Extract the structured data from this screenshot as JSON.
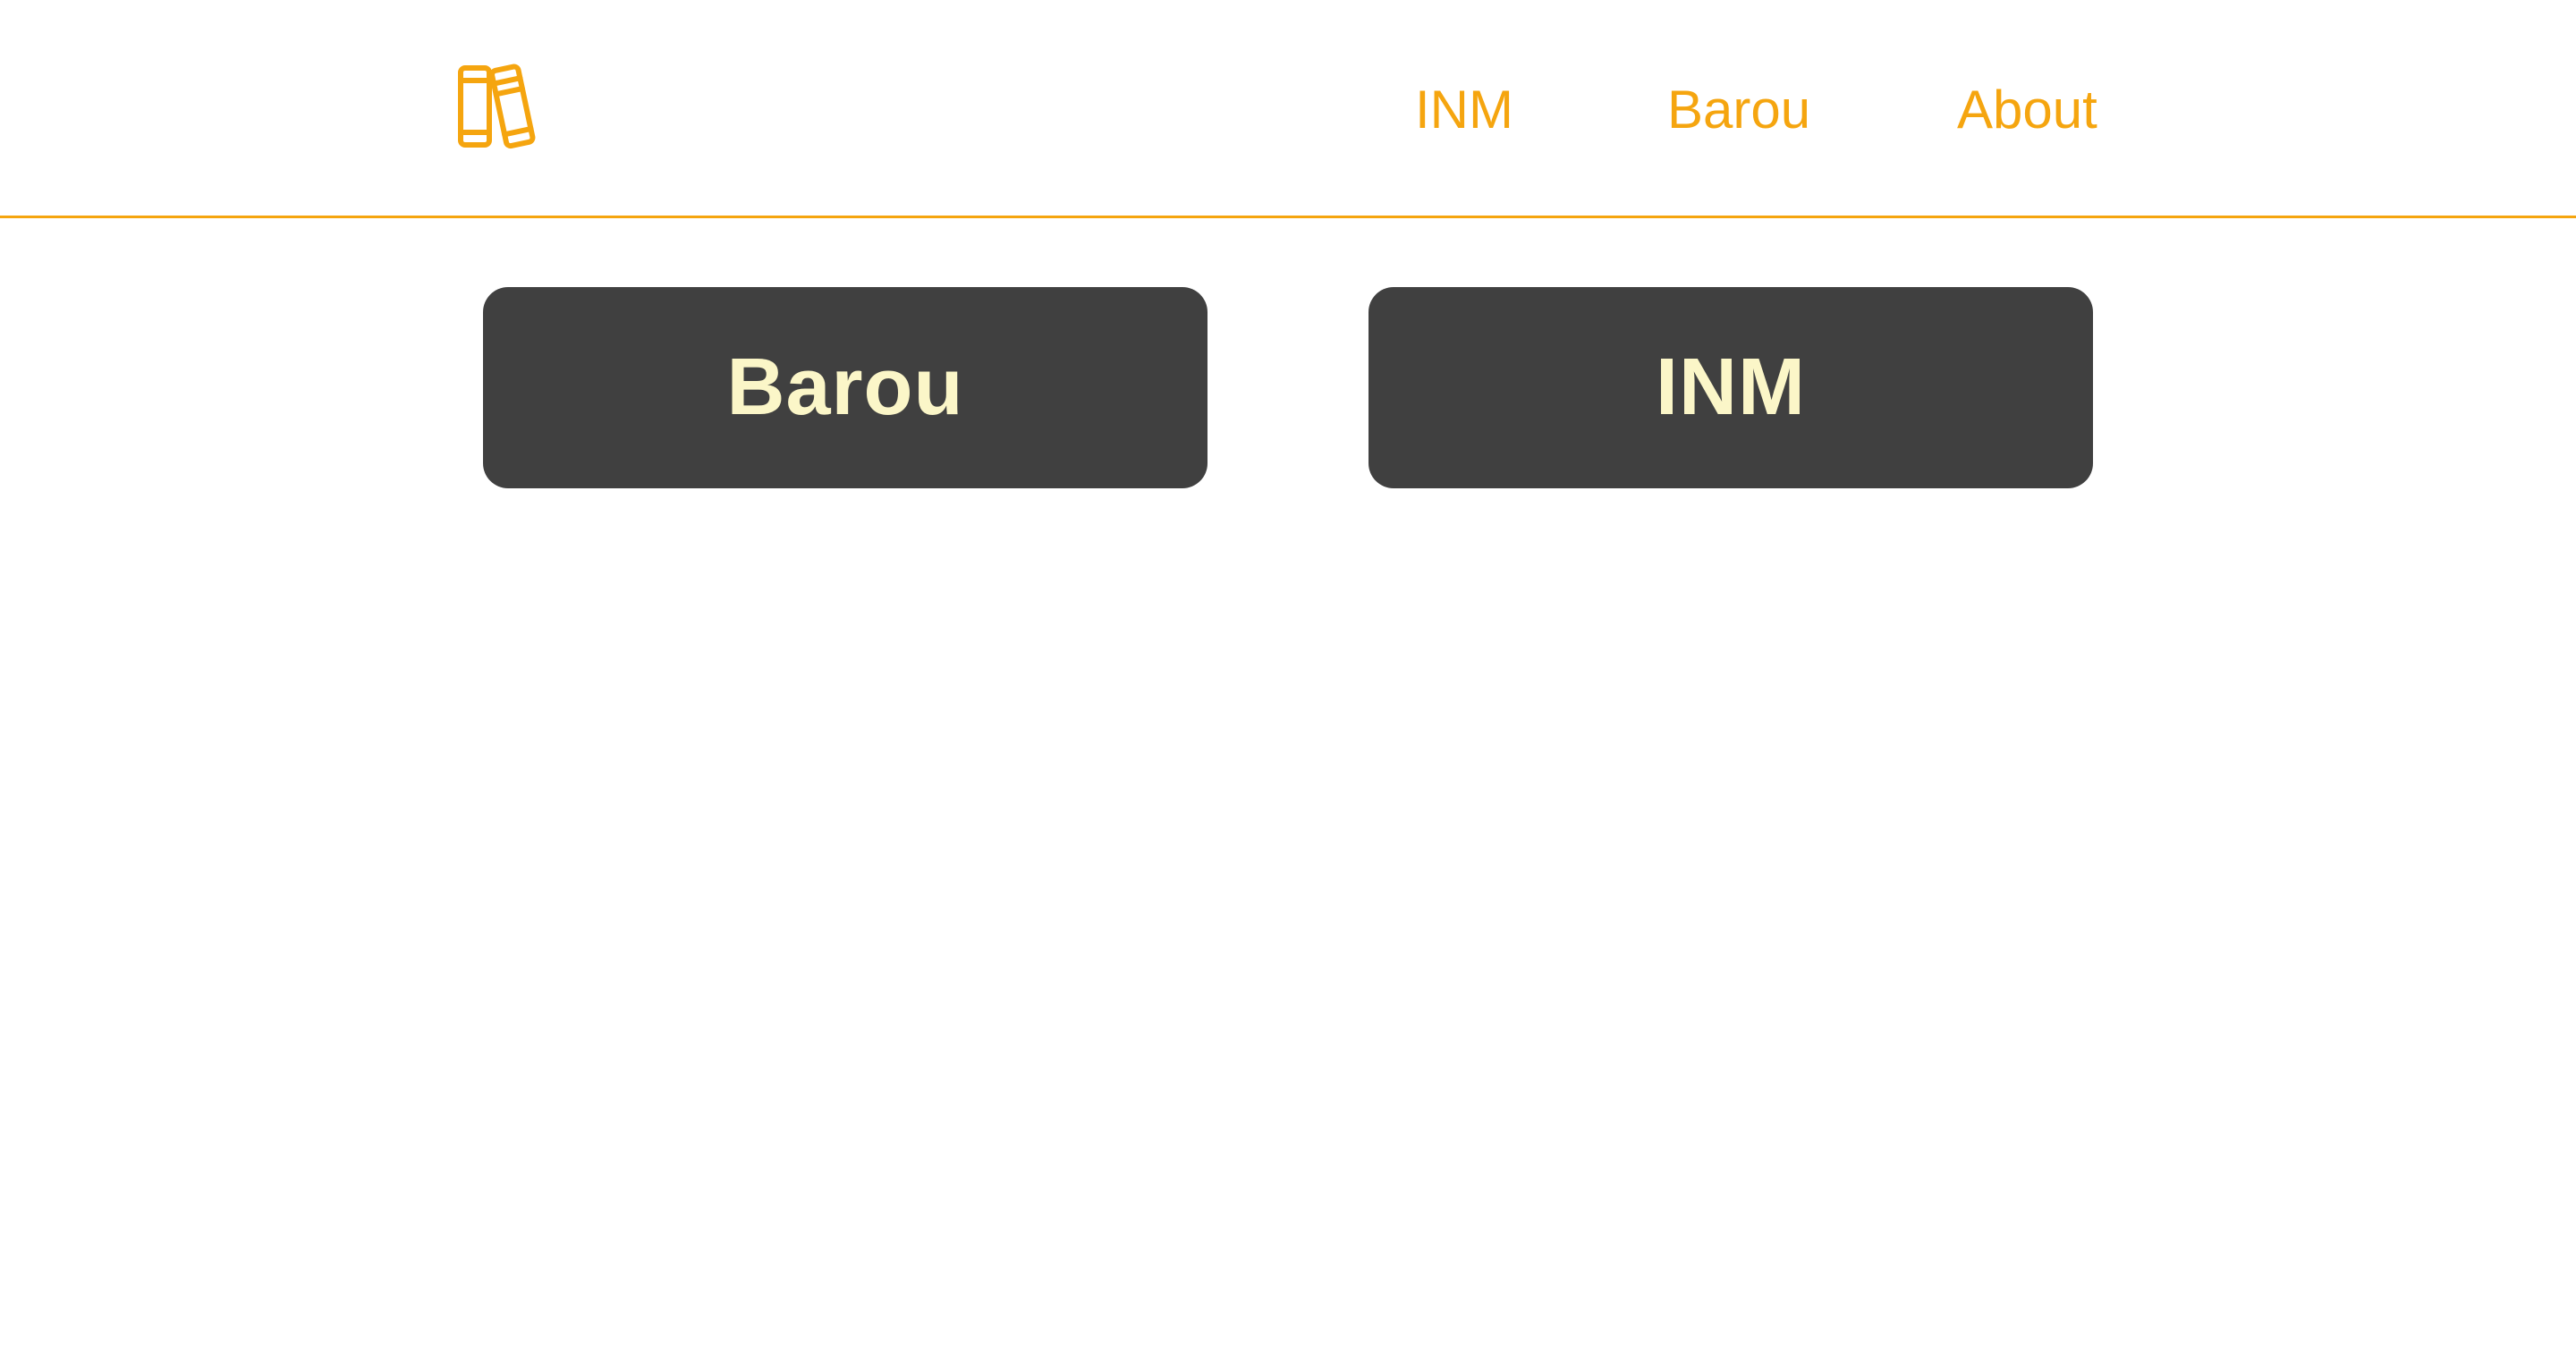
{
  "colors": {
    "accent": "#f5a50f",
    "card_bg": "#404040",
    "card_text": "#fbf6c8",
    "page_bg": "#ffffff"
  },
  "header": {
    "logo_icon": "books-icon",
    "nav": [
      {
        "label": "INM"
      },
      {
        "label": "Barou"
      },
      {
        "label": "About"
      }
    ]
  },
  "main": {
    "cards": [
      {
        "label": "Barou"
      },
      {
        "label": "INM"
      }
    ]
  }
}
